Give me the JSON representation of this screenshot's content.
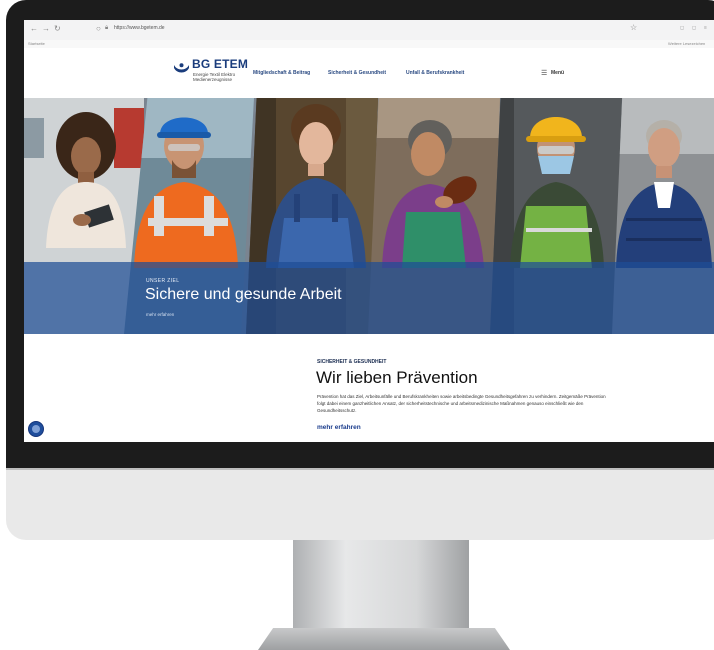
{
  "browser": {
    "url": "https://www.bgetem.de",
    "bookmark_left": "Startseite",
    "bookmark_right": "Weitere Lesezeichen"
  },
  "site": {
    "logo_name": "BG ETEM",
    "logo_tagline": "Energie Textil Elektro Medienerzeugnisse",
    "nav": [
      "Mitgliedschaft & Beitrag",
      "Sicherheit & Gesundheit",
      "Unfall & Berufskrankheit"
    ],
    "menu_label": "Menü"
  },
  "hero": {
    "kicker": "UNSER ZIEL",
    "title": "Sichere und gesunde Arbeit",
    "link": "mehr erfahren"
  },
  "section": {
    "kicker": "SICHERHEIT & GESUNDHEIT",
    "title": "Wir lieben Prävention",
    "body": "Prävention hat das Ziel, Arbeitsunfälle und Berufskrankheiten sowie arbeitsbedingte Gesundheitsgefahren zu verhindern. Zeitgemäße Prävention folgt dabei einem ganzheitlichen Ansatz, der sicherheitstechnische und arbeitsmedizinische Maßnahmen genauso einschließt wie den Gesundheitsschutz.",
    "link": "mehr erfahren"
  },
  "colors": {
    "brand": "#1a3c7c",
    "hero_band": "#1e4e96",
    "accessibility_button": "#1f4e9c"
  }
}
